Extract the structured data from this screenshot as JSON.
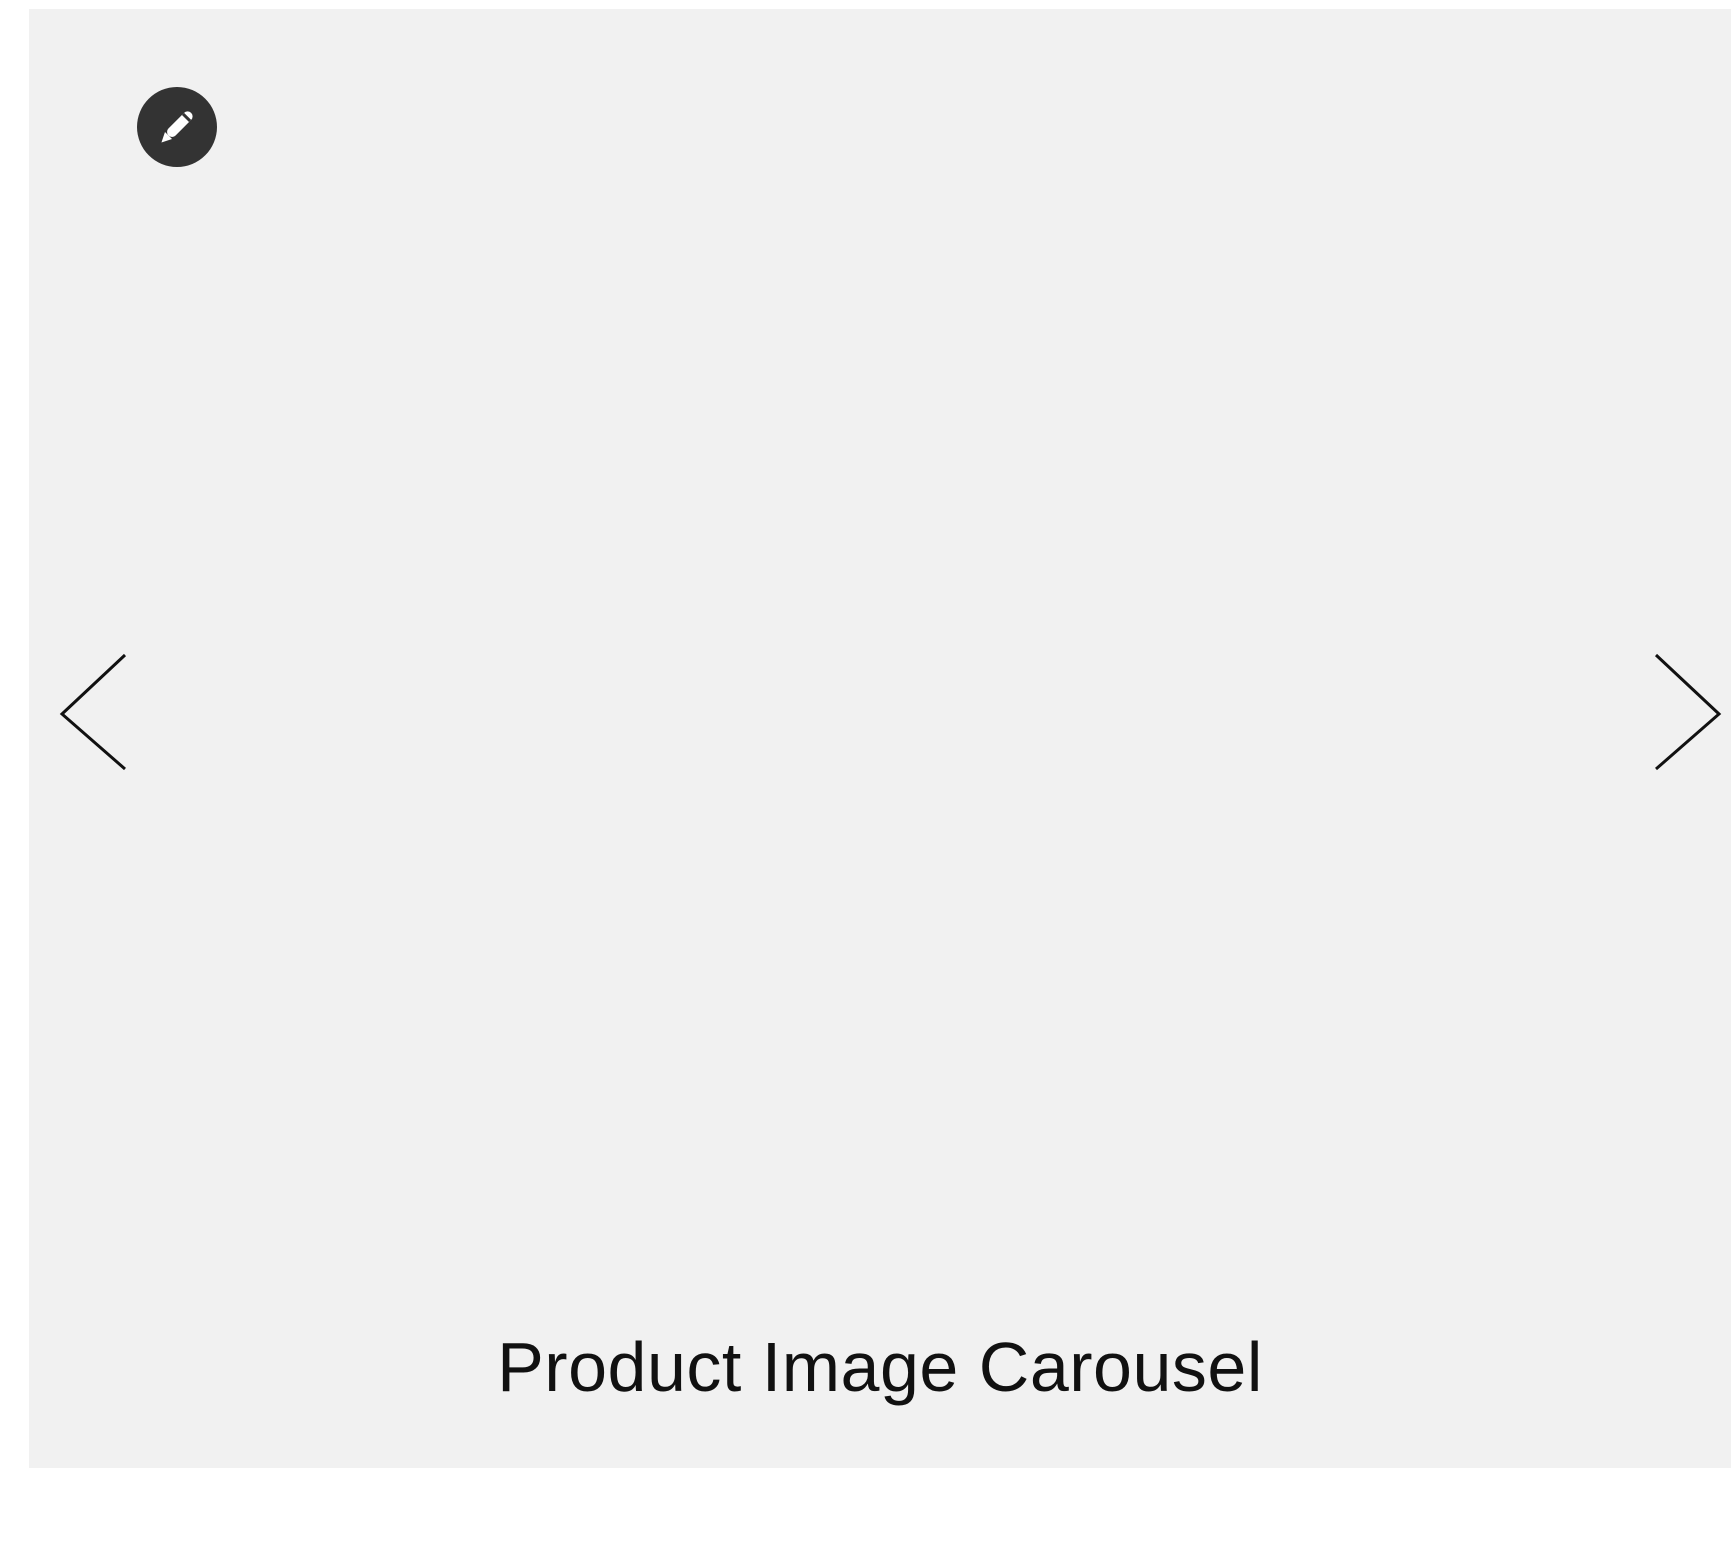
{
  "carousel": {
    "caption": "Product Image Carousel",
    "background_color": "#f1f1f1",
    "edit_button": {
      "icon": "pencil-icon",
      "color": "#333333"
    },
    "prev_icon": "chevron-left-icon",
    "next_icon": "chevron-right-icon"
  }
}
